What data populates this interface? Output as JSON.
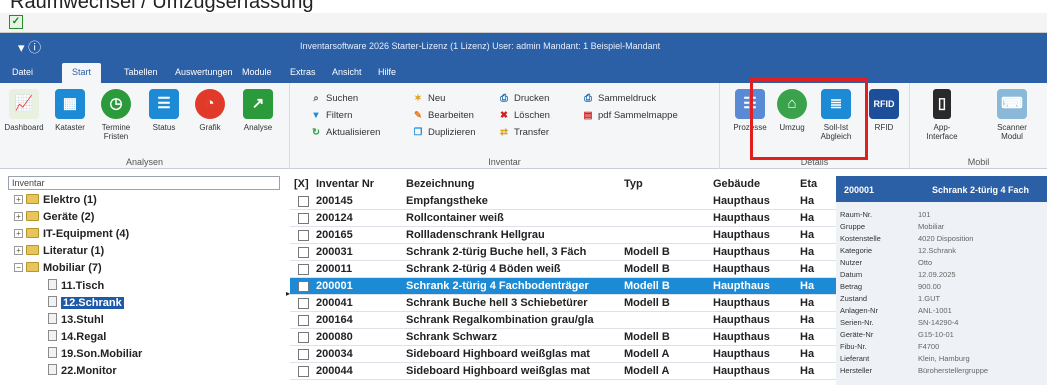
{
  "heading": "Raumwechsel / Umzugserfassung",
  "titlebar": {
    "info": "Inventarsoftware 2026 Starter-Lizenz (1 Lizenz)   User: admin   Mandant: 1 Beispiel-Mandant"
  },
  "menu": [
    "Datei",
    "Start",
    "Tabellen",
    "Auswertungen",
    "Module",
    "Extras",
    "Ansicht",
    "Hilfe"
  ],
  "ribbon": {
    "analysen": {
      "name": "Analysen",
      "buttons": [
        "Dashboard",
        "Kataster",
        "Termine Fristen",
        "Status",
        "Grafik",
        "Analyse"
      ]
    },
    "inventar": {
      "name": "Inventar",
      "col1": [
        "Suchen",
        "Filtern",
        "Aktualisieren"
      ],
      "col2": [
        "Neu",
        "Bearbeiten",
        "Duplizieren"
      ],
      "col3": [
        "Drucken",
        "Löschen",
        "Transfer"
      ],
      "col4": [
        "Sammeldruck",
        "pdf Sammelmappe"
      ]
    },
    "details": {
      "name": "Details",
      "buttons": [
        "Prozesse",
        "Umzug",
        "Soll-Ist Abgleich",
        "RFID"
      ]
    },
    "mobil": {
      "name": "Mobil",
      "buttons": [
        "App-Interface",
        "Scanner Modul"
      ]
    }
  },
  "tree": {
    "header": "Inventar",
    "nodes": [
      {
        "label": "Elektro  (1)",
        "expander": "+"
      },
      {
        "label": "Geräte  (2)",
        "expander": "+"
      },
      {
        "label": "IT-Equipment  (4)",
        "expander": "+"
      },
      {
        "label": "Literatur  (1)",
        "expander": "+"
      },
      {
        "label": "Mobiliar  (7)",
        "expander": "−"
      },
      {
        "label": "11.Tisch"
      },
      {
        "label": "12.Schrank",
        "selected": true
      },
      {
        "label": "13.Stuhl"
      },
      {
        "label": "14.Regal"
      },
      {
        "label": "19.Son.Mobiliar"
      },
      {
        "label": "22.Monitor"
      }
    ]
  },
  "grid": {
    "headers": [
      "[X]",
      "Inventar Nr",
      "Bezeichnung",
      "Typ",
      "Gebäude",
      "Eta"
    ],
    "rows": [
      {
        "nr": "200145",
        "bez": "Empfangstheke",
        "typ": "",
        "geb": "Haupthaus",
        "eta": "Ha"
      },
      {
        "nr": "200124",
        "bez": "Rollcontainer weiß",
        "typ": "",
        "geb": "Haupthaus",
        "eta": "Ha"
      },
      {
        "nr": "200165",
        "bez": "Rollladenschrank Hellgrau",
        "typ": "",
        "geb": "Haupthaus",
        "eta": "Ha"
      },
      {
        "nr": "200031",
        "bez": "Schrank  2-türig Buche hell, 3 Fäch",
        "typ": "Modell B",
        "geb": "Haupthaus",
        "eta": "Ha"
      },
      {
        "nr": "200011",
        "bez": "Schrank 2-türig 4 Böden weiß",
        "typ": "Modell B",
        "geb": "Haupthaus",
        "eta": "Ha"
      },
      {
        "nr": "200001",
        "bez": "Schrank 2-türig 4 Fachbodenträger",
        "typ": "Modell B",
        "geb": "Haupthaus",
        "eta": "Ha",
        "selected": true
      },
      {
        "nr": "200041",
        "bez": "Schrank Buche hell 3 Schiebetürer",
        "typ": "Modell B",
        "geb": "Haupthaus",
        "eta": "Ha"
      },
      {
        "nr": "200164",
        "bez": "Schrank Regalkombination grau/gla",
        "typ": "",
        "geb": "Haupthaus",
        "eta": "Ha"
      },
      {
        "nr": "200080",
        "bez": "Schrank Schwarz",
        "typ": "Modell B",
        "geb": "Haupthaus",
        "eta": "Ha"
      },
      {
        "nr": "200034",
        "bez": "Sideboard Highboard weißglas mat",
        "typ": "Modell A",
        "geb": "Haupthaus",
        "eta": "Ha"
      },
      {
        "nr": "200044",
        "bez": "Sideboard Highboard weißglas mat",
        "typ": "Modell A",
        "geb": "Haupthaus",
        "eta": "Ha"
      }
    ]
  },
  "detail": {
    "header_id": "200001",
    "header_name": "Schrank 2-türig 4 Fach",
    "fields": [
      {
        "k": "Raum-Nr.",
        "v": "101"
      },
      {
        "k": "Gruppe",
        "v": "Mobiliar"
      },
      {
        "k": "Kostenstelle",
        "v": "4020 Disposition"
      },
      {
        "k": "Kategorie",
        "v": "12.Schrank"
      },
      {
        "k": "Nutzer",
        "v": "Otto"
      },
      {
        "k": "Datum",
        "v": "12.09.2025"
      },
      {
        "k": "Betrag",
        "v": "900.00"
      },
      {
        "k": "Zustand",
        "v": "1.GUT"
      },
      {
        "k": "Anlagen-Nr",
        "v": "ANL-1001"
      },
      {
        "k": "Serien-Nr.",
        "v": "SN-14290-4"
      },
      {
        "k": "Geräte-Nr",
        "v": "G15-10-01"
      },
      {
        "k": "Fibu-Nr.",
        "v": "F4700"
      },
      {
        "k": "Lieferant",
        "v": "Klein, Hamburg"
      },
      {
        "k": "Hersteller",
        "v": "Büroherstellergruppe"
      }
    ]
  },
  "colors": {
    "titlebar": "#2b5fa6",
    "selection": "#1d8ad6",
    "highlight": "#e02020"
  }
}
